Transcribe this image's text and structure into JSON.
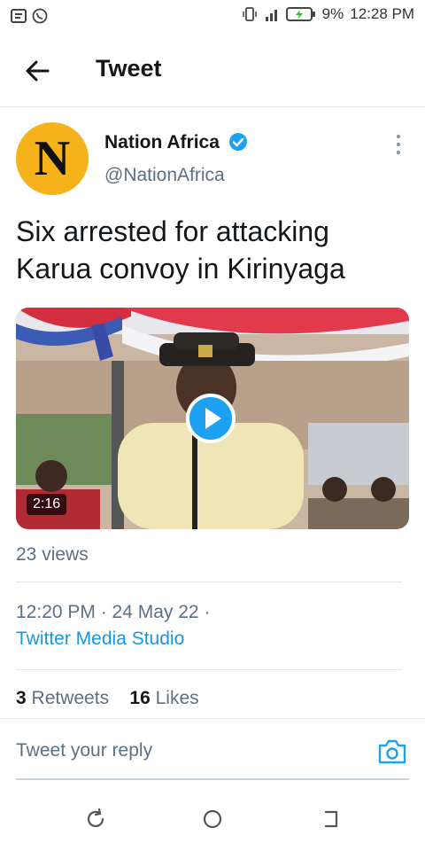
{
  "status_bar": {
    "battery_percent": "9%",
    "time": "12:28 PM"
  },
  "header": {
    "title": "Tweet"
  },
  "tweet": {
    "author_name": "Nation Africa",
    "author_handle": "@NationAfrica",
    "avatar_letter": "N",
    "text": "Six arrested for attacking Karua convoy in Kirinyaga",
    "video_duration": "2:16",
    "views": "23 views",
    "timestamp": "12:20 PM · 24 May 22 ·",
    "source": "Twitter Media Studio",
    "retweets_count": "3",
    "retweets_label": "Retweets",
    "likes_count": "16",
    "likes_label": "Likes"
  },
  "reply": {
    "placeholder": "Tweet your reply"
  },
  "colors": {
    "accent": "#1b95e0",
    "avatar_bg": "#f6b21b",
    "verified": "#1da1f2"
  }
}
